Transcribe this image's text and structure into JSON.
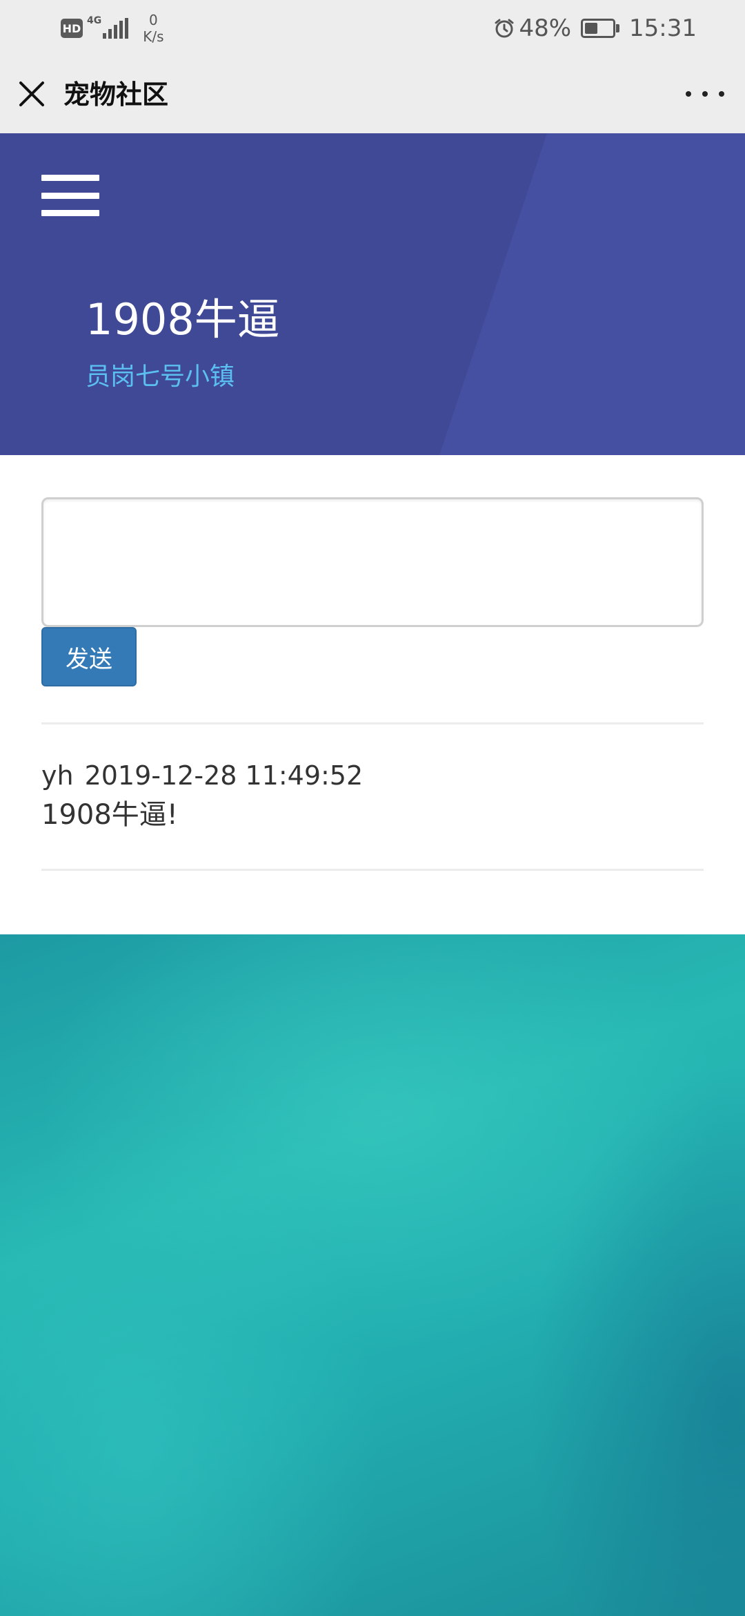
{
  "status_bar": {
    "hd": "HD",
    "network": "4G",
    "speed_value": "0",
    "speed_unit": "K/s",
    "battery_percent": "48%",
    "battery_level": 0.48,
    "time": "15:31"
  },
  "nav": {
    "title": "宠物社区"
  },
  "banner": {
    "title": "1908牛逼",
    "subtitle": "员岗七号小镇",
    "colors": {
      "background": "#3f4995",
      "stripe": "#4650a2",
      "subtitle": "#5bc0f0"
    }
  },
  "compose": {
    "input_value": "",
    "send_label": "发送"
  },
  "posts": [
    {
      "author": "yh",
      "timestamp": "2019-12-28 11:49:52",
      "content": "1908牛逼!"
    }
  ],
  "icons": {
    "close": "close-icon",
    "more": "more-icon",
    "menu": "hamburger-icon",
    "alarm": "alarm-icon",
    "battery": "battery-icon",
    "signal": "signal-icon"
  }
}
